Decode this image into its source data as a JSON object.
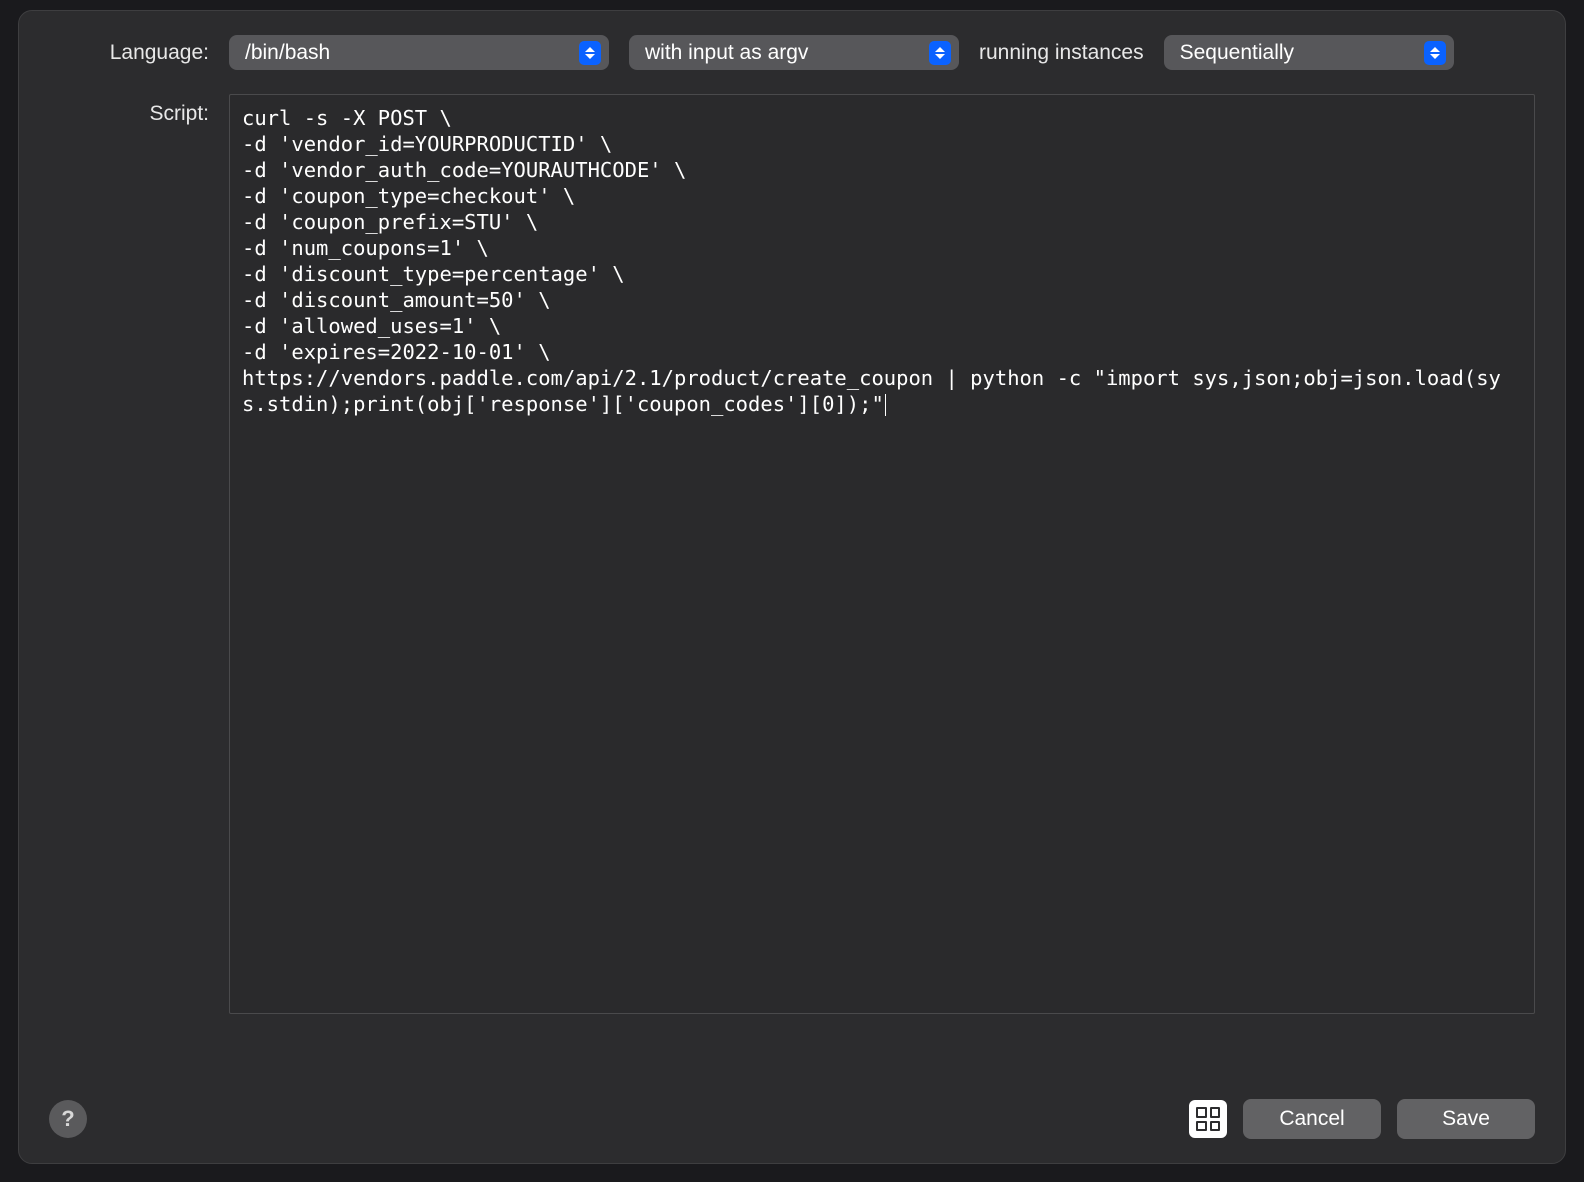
{
  "header": {
    "language_label": "Language:",
    "language_value": "/bin/bash",
    "input_mode_value": "with input as argv",
    "running_instances_label": "running instances",
    "running_instances_value": "Sequentially"
  },
  "script_label": "Script:",
  "script_content": "curl -s -X POST \\\n-d 'vendor_id=YOURPRODUCTID' \\\n-d 'vendor_auth_code=YOURAUTHCODE' \\\n-d 'coupon_type=checkout' \\\n-d 'coupon_prefix=STU' \\\n-d 'num_coupons=1' \\\n-d 'discount_type=percentage' \\\n-d 'discount_amount=50' \\\n-d 'allowed_uses=1' \\\n-d 'expires=2022-10-01' \\\nhttps://vendors.paddle.com/api/2.1/product/create_coupon | python -c \"import sys,json;obj=json.load(sys.stdin);print(obj['response']['coupon_codes'][0]);\"",
  "footer": {
    "help_symbol": "?",
    "cancel_label": "Cancel",
    "save_label": "Save"
  }
}
